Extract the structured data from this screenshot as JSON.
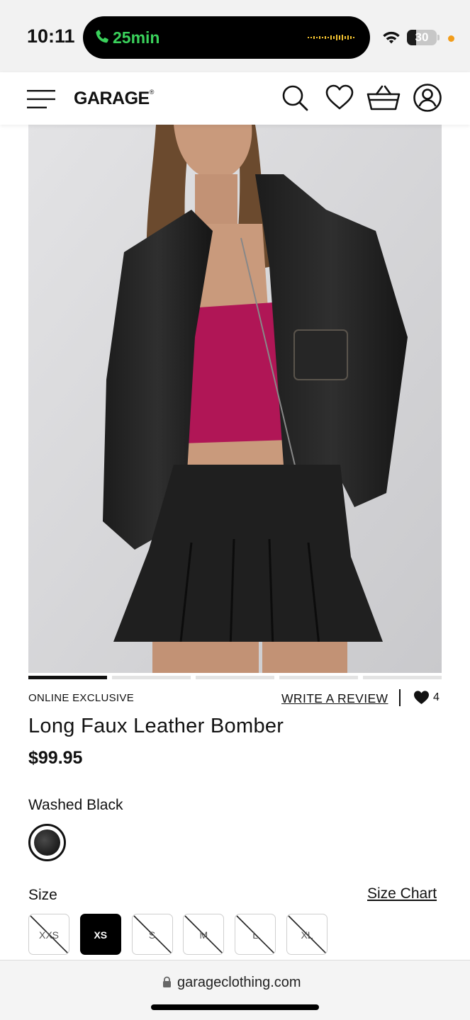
{
  "status_bar": {
    "time": "10:11",
    "call_duration": "25min",
    "battery_level": "30",
    "battery_fraction": 0.3,
    "colors": {
      "call": "#3ad15b",
      "privacy_dot": "#f29d1b"
    },
    "icons": [
      "phone-icon",
      "wifi-icon",
      "battery-icon"
    ]
  },
  "header": {
    "logo": "GARAGE",
    "logo_mark": "®",
    "icons": [
      "menu-icon",
      "search-icon",
      "heart-icon",
      "basket-icon",
      "account-icon"
    ]
  },
  "gallery": {
    "image_count": 5,
    "active_index": 0
  },
  "product": {
    "badge": "ONLINE EXCLUSIVE",
    "review_link": "WRITE A REVIEW",
    "favorites_count": "4",
    "title": "Long Faux Leather Bomber",
    "price": "$99.95",
    "color_name": "Washed Black"
  },
  "size": {
    "label": "Size",
    "chart_link": "Size Chart",
    "options": [
      {
        "label": "XXS",
        "available": false,
        "selected": false
      },
      {
        "label": "XS",
        "available": true,
        "selected": true
      },
      {
        "label": "S",
        "available": false,
        "selected": false
      },
      {
        "label": "M",
        "available": false,
        "selected": false
      },
      {
        "label": "L",
        "available": false,
        "selected": false
      },
      {
        "label": "XL",
        "available": false,
        "selected": false
      }
    ]
  },
  "browser": {
    "url": "garageclothing.com"
  }
}
